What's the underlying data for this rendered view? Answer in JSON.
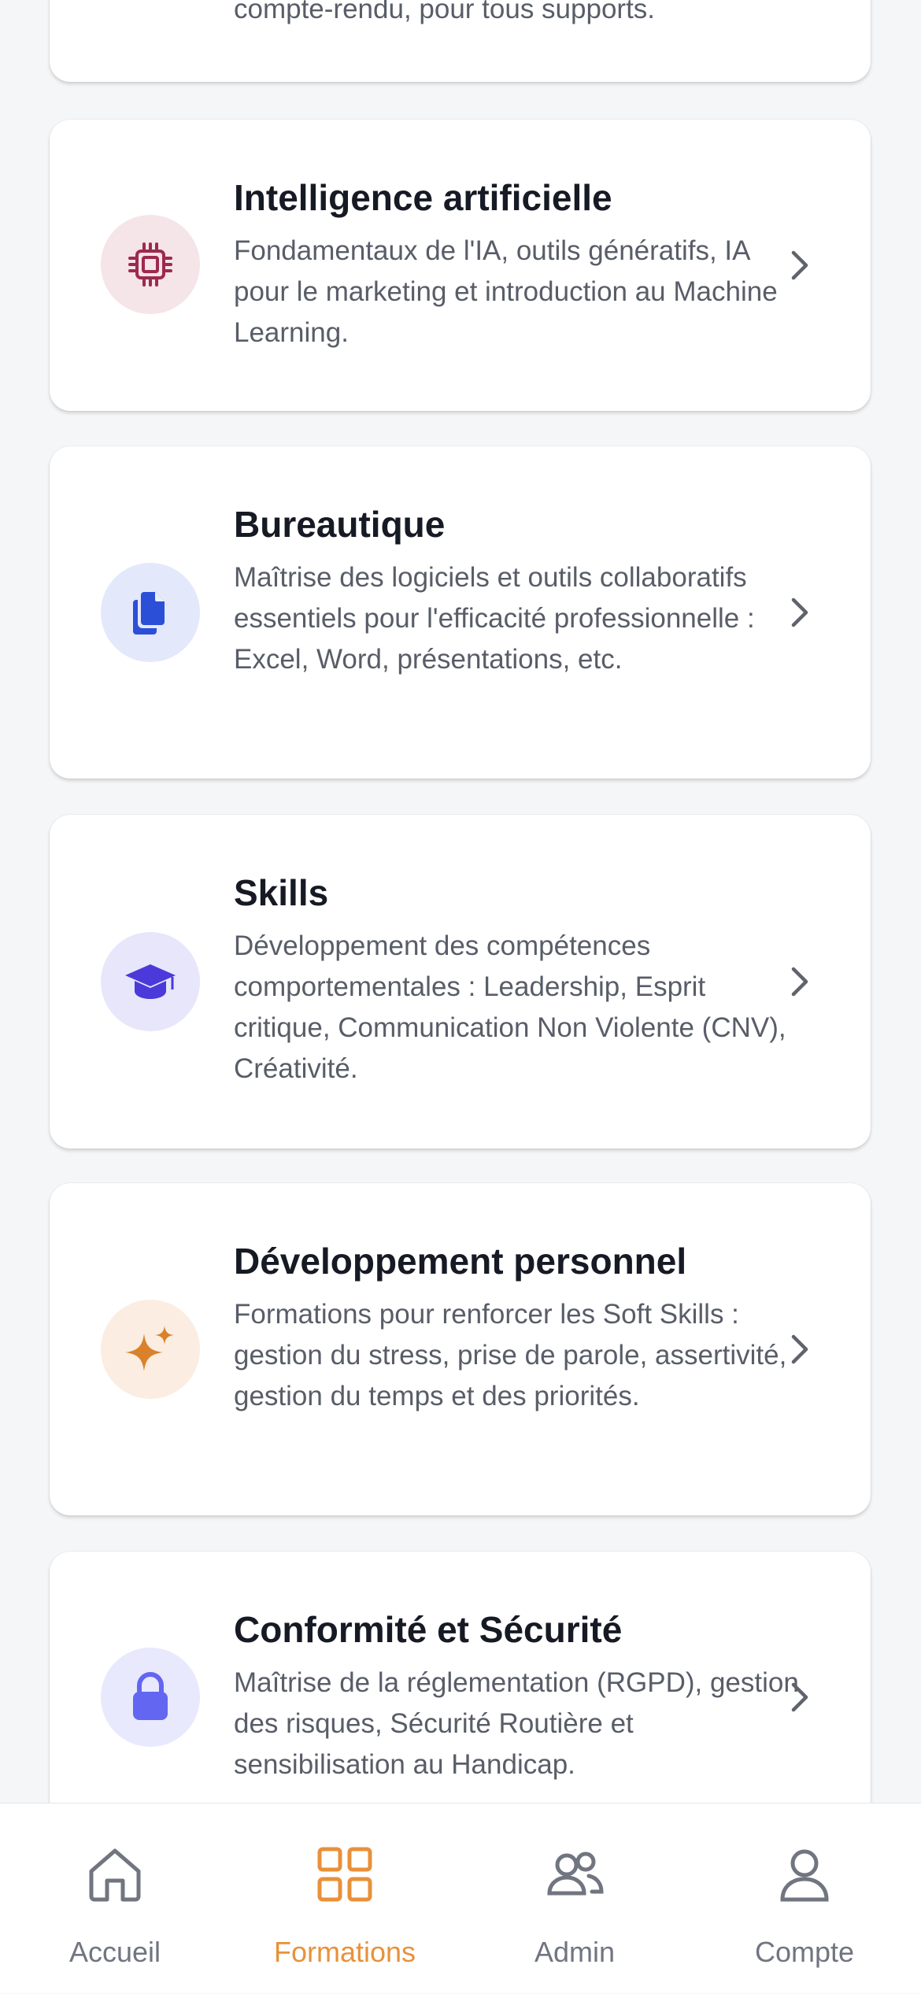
{
  "partial_card": {
    "description_tail": "compte-rendu, pour tous supports."
  },
  "categories": [
    {
      "title": "Intelligence artificielle",
      "description": "Fondamentaux de l'IA, outils génératifs, IA pour le marketing et introduction au Machine Learning.",
      "icon": "chip-icon",
      "icon_color": "#9c2a4c",
      "icon_bg": "#f5e4e8"
    },
    {
      "title": "Bureautique",
      "description": "Maîtrise des logiciels et outils collaboratifs essentiels pour l'efficacité professionnelle : Excel, Word, présentations, etc.",
      "icon": "documents-icon",
      "icon_color": "#2c4fd8",
      "icon_bg": "#e3e8fb"
    },
    {
      "title": "Skills",
      "description": "Développement des compétences comportementales : Leadership, Esprit critique, Communication Non Violente (CNV), Créativité.",
      "icon": "graduation-cap-icon",
      "icon_color": "#4b3ad9",
      "icon_bg": "#e8e6fb"
    },
    {
      "title": "Développement personnel",
      "description": "Formations pour renforcer les Soft Skills : gestion du stress, prise de parole, assertivité, gestion du temps et des priorités.",
      "icon": "sparkles-icon",
      "icon_color": "#d9822b",
      "icon_bg": "#fbede1"
    },
    {
      "title": "Conformité et Sécurité",
      "description": "Maîtrise de la réglementation (RGPD), gestion des risques, Sécurité Routière et sensibilisation au Handicap.",
      "icon": "lock-icon",
      "icon_color": "#6366f1",
      "icon_bg": "#e8e9fd"
    }
  ],
  "tabbar": {
    "active": "Formations",
    "accent_color": "#e8913a",
    "inactive_color": "#707580",
    "tabs": [
      {
        "label": "Accueil",
        "icon": "home-icon"
      },
      {
        "label": "Formations",
        "icon": "grid-icon"
      },
      {
        "label": "Admin",
        "icon": "users-icon"
      },
      {
        "label": "Compte",
        "icon": "user-icon"
      }
    ]
  }
}
